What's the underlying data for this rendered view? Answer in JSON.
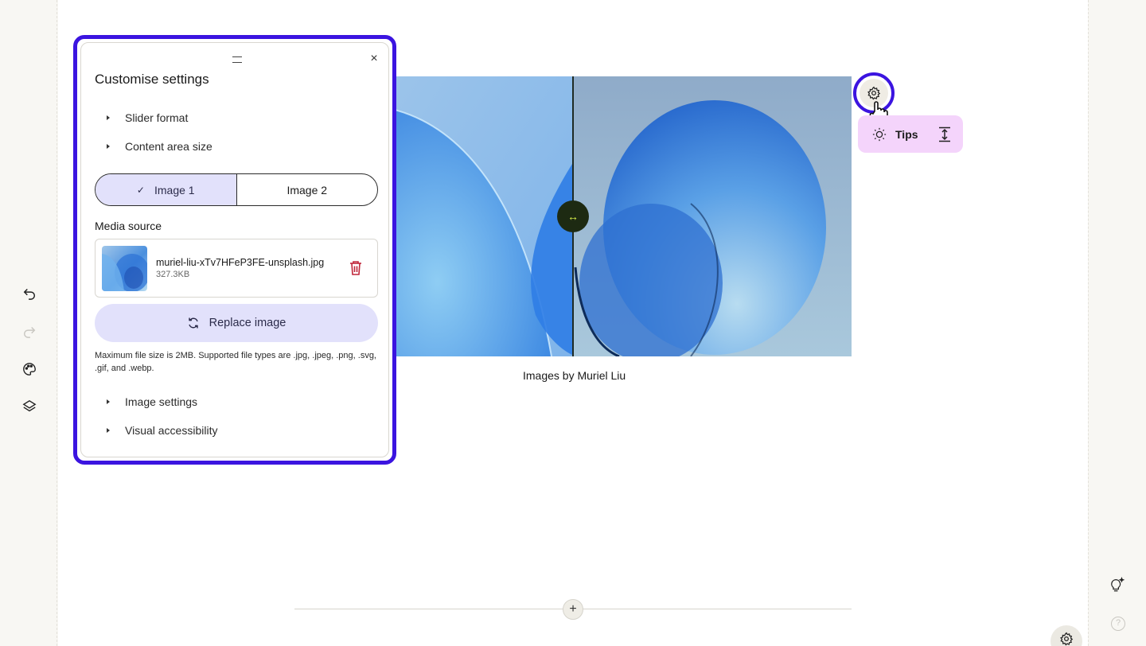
{
  "panel": {
    "title": "Customise settings",
    "close_icon": "×",
    "accordion_top": [
      {
        "label": "Slider format"
      },
      {
        "label": "Content area size"
      }
    ],
    "tabs": [
      {
        "label": "Image 1",
        "selected": true
      },
      {
        "label": "Image 2",
        "selected": false
      }
    ],
    "media_source_label": "Media source",
    "media_file": {
      "name": "muriel-liu-xTv7HFeP3FE-unsplash.jpg",
      "size": "327.3KB"
    },
    "replace_label": "Replace image",
    "help_text": "Maximum file size is 2MB. Supported file types are .jpg, .jpeg, .png, .svg, .gif, and .webp.",
    "accordion_bottom": [
      {
        "label": "Image settings"
      },
      {
        "label": "Visual accessibility"
      }
    ]
  },
  "stage": {
    "caption": "Images by Muriel Liu",
    "handle_glyph": "↔"
  },
  "floating": {
    "tips_label": "Tips"
  },
  "add_section_glyph": "+",
  "help_glyph": "?",
  "colors": {
    "accent_outline": "#3b14e0",
    "selected_bg": "#e2e1fb",
    "tips_bg": "#f4d4fb",
    "delete_red": "#c0263a",
    "handle_bg": "#1d2a12"
  },
  "icons": [
    "undo-icon",
    "redo-icon",
    "palette-icon",
    "layers-icon",
    "gear-icon",
    "bulb-icon",
    "vertical-resize-icon",
    "trash-icon",
    "refresh-icon",
    "check-icon",
    "ai-bulb-icon",
    "help-icon"
  ]
}
